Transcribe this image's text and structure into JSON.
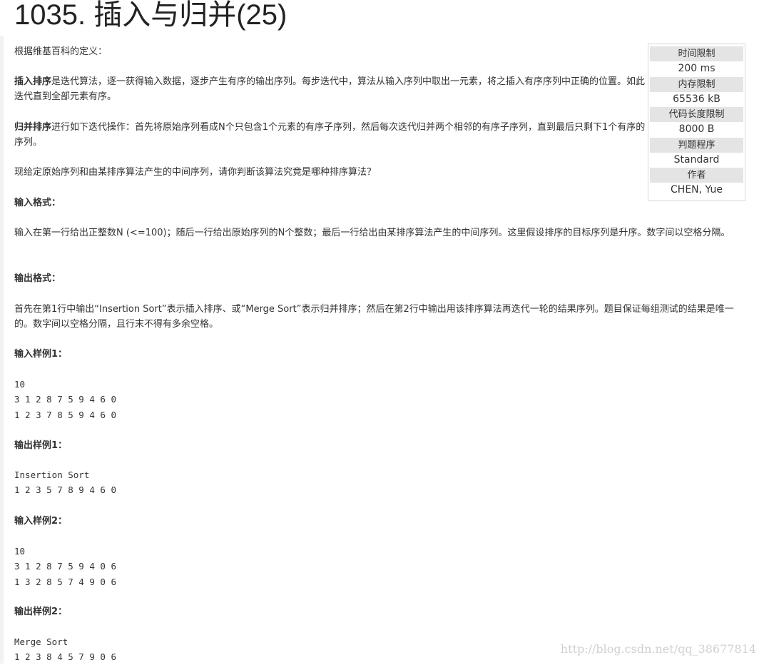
{
  "problem": {
    "title": "1035. 插入与归并(25)",
    "intro": "根据维基百科的定义：",
    "insertion_term": "插入排序",
    "insertion_desc": "是迭代算法，逐一获得输入数据，逐步产生有序的输出序列。每步迭代中，算法从输入序列中取出一元素，将之插入有序序列中正确的位置。如此迭代直到全部元素有序。",
    "merge_term": "归并排序",
    "merge_desc": "进行如下迭代操作：首先将原始序列看成N个只包含1个元素的有序子序列，然后每次迭代归并两个相邻的有序子序列，直到最后只剩下1个有序的序列。",
    "task": "现给定原始序列和由某排序算法产生的中间序列，请你判断该算法究竟是哪种排序算法？",
    "input_heading": "输入格式：",
    "input_desc": "输入在第一行给出正整数N (<=100)；随后一行给出原始序列的N个整数；最后一行给出由某排序算法产生的中间序列。这里假设排序的目标序列是升序。数字间以空格分隔。",
    "output_heading": "输出格式：",
    "output_desc": "首先在第1行中输出“Insertion Sort”表示插入排序、或“Merge Sort”表示归并排序；然后在第2行中输出用该排序算法再迭代一轮的结果序列。题目保证每组测试的结果是唯一的。数字间以空格分隔，且行末不得有多余空格。"
  },
  "samples": [
    {
      "heading": "输入样例1：",
      "lines": [
        "10",
        "3 1 2 8 7 5 9 4 6 0",
        "1 2 3 7 8 5 9 4 6 0"
      ]
    },
    {
      "heading": "输出样例1：",
      "lines": [
        "Insertion Sort",
        "1 2 3 5 7 8 9 4 6 0"
      ]
    },
    {
      "heading": "输入样例2：",
      "lines": [
        "10",
        "3 1 2 8 7 5 9 4 0 6",
        "1 3 2 8 5 7 4 9 0 6"
      ]
    },
    {
      "heading": "输出样例2：",
      "lines": [
        "Merge Sort",
        "1 2 3 8 4 5 7 9 0 6"
      ]
    }
  ],
  "info": {
    "time_label": "时间限制",
    "time_value": "200 ms",
    "memory_label": "内存限制",
    "memory_value": "65536 kB",
    "code_label": "代码长度限制",
    "code_value": "8000 B",
    "judge_label": "判题程序",
    "judge_value": "Standard",
    "author_label": "作者",
    "author_value": "CHEN, Yue"
  },
  "watermark": "http://blog.csdn.net/qq_38677814"
}
